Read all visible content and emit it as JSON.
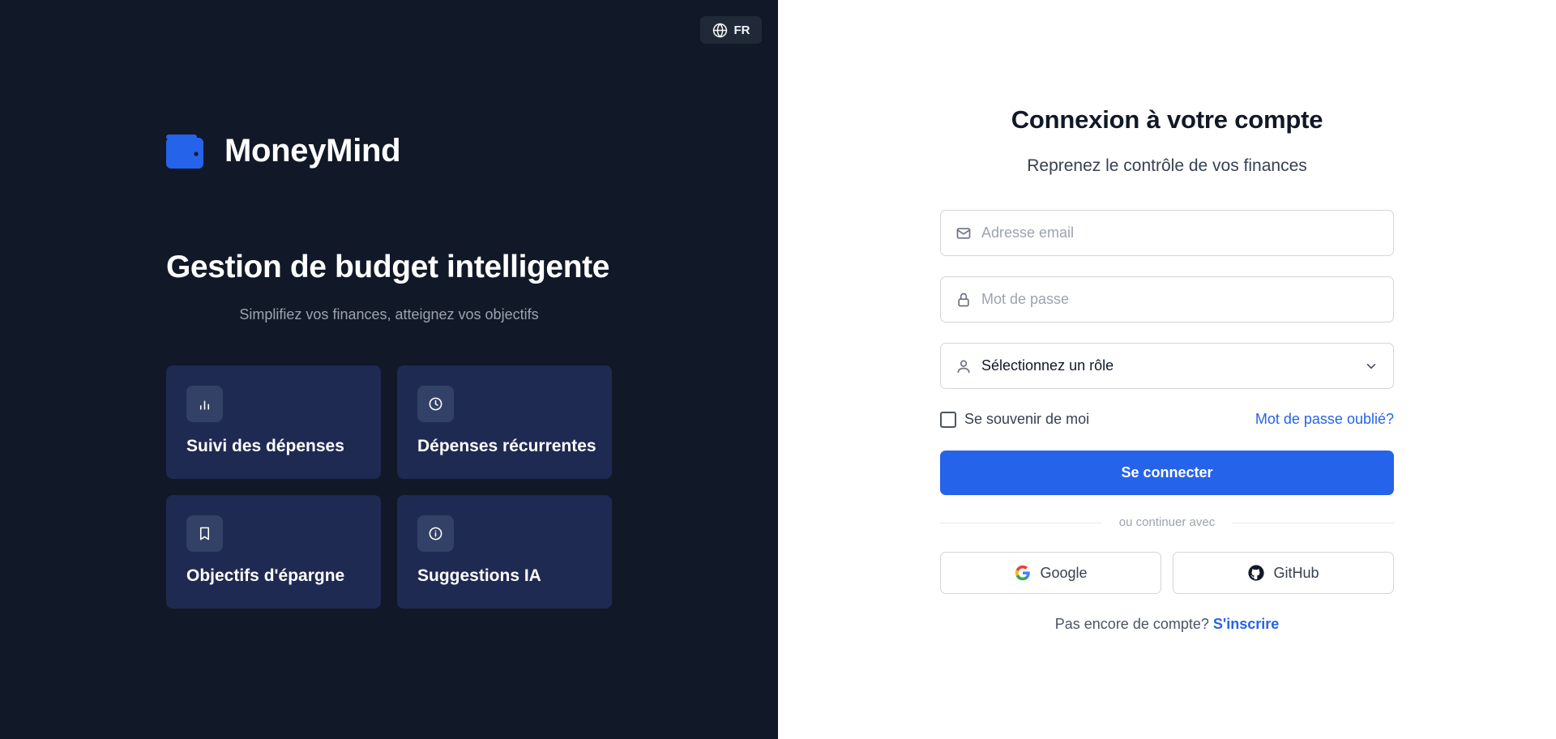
{
  "lang": {
    "code": "FR",
    "icon": "globe-icon"
  },
  "brand": {
    "name": "MoneyMind",
    "icon": "wallet-icon",
    "color": "#2563eb"
  },
  "hero": {
    "title": "Gestion de budget intelligente",
    "subtitle": "Simplifiez vos finances, atteignez vos objectifs"
  },
  "features": [
    {
      "label": "Suivi des dépenses",
      "icon": "bar-chart-icon"
    },
    {
      "label": "Dépenses récurrentes",
      "icon": "clock-icon"
    },
    {
      "label": "Objectifs d'épargne",
      "icon": "bookmark-icon"
    },
    {
      "label": "Suggestions IA",
      "icon": "info-icon"
    }
  ],
  "form": {
    "title": "Connexion à votre compte",
    "subtitle": "Reprenez le contrôle de vos finances",
    "email_placeholder": "Adresse email",
    "password_placeholder": "Mot de passe",
    "role_value": "Sélectionnez un rôle",
    "remember_label": "Se souvenir de moi",
    "remember_checked": false,
    "forgot_label": "Mot de passe oublié?",
    "submit_label": "Se connecter",
    "divider_text": "ou continuer avec",
    "google_label": "Google",
    "github_label": "GitHub",
    "signup_prompt": "Pas encore de compte?",
    "signup_link": "S'inscrire"
  },
  "colors": {
    "left_bg": "#111827",
    "card_bg": "#1e2a52",
    "accent": "#2563eb"
  }
}
